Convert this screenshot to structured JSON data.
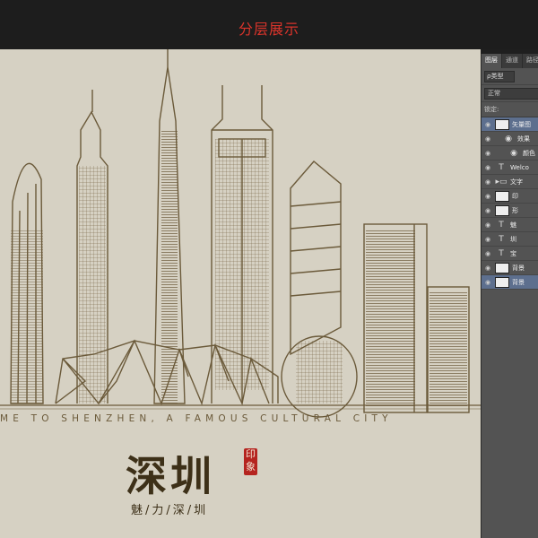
{
  "header": {
    "title": "分层展示"
  },
  "canvas": {
    "tagline": "ME TO SHENZHEN, A FAMOUS CULTURAL CITY",
    "title": "深圳",
    "seal": "印象",
    "subtitle": "魅/力/深/圳"
  },
  "panel": {
    "tabs": [
      "图层",
      "通道",
      "路径"
    ],
    "filter": "ρ类型",
    "blend_mode": "正常",
    "lock_label": "锁定:",
    "layers": [
      {
        "name": "矢量图",
        "kind": "image",
        "selected": true
      },
      {
        "name": "效果",
        "kind": "effect"
      },
      {
        "name": "颜色",
        "kind": "effect2"
      },
      {
        "name": "Welco",
        "kind": "text"
      },
      {
        "name": "文字",
        "kind": "group"
      },
      {
        "name": "印",
        "kind": "image"
      },
      {
        "name": "形",
        "kind": "image"
      },
      {
        "name": "魅",
        "kind": "text"
      },
      {
        "name": "圳",
        "kind": "text"
      },
      {
        "name": "宝",
        "kind": "text"
      },
      {
        "name": "背景",
        "kind": "image"
      },
      {
        "name": "背景",
        "kind": "image",
        "selected": true
      }
    ]
  }
}
